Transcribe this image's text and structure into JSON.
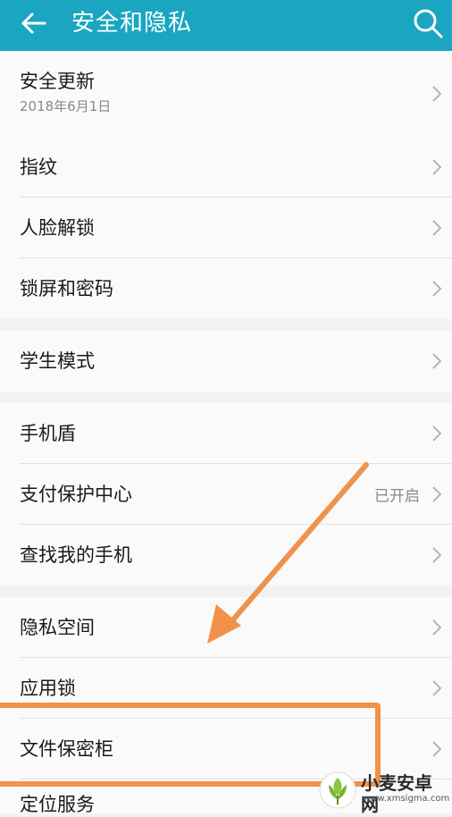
{
  "header": {
    "title": "安全和隐私",
    "back_icon": "arrow-left-icon",
    "search_icon": "search-icon"
  },
  "groups": [
    {
      "items": [
        {
          "label": "安全更新",
          "sub": "2018年6月1日"
        }
      ]
    },
    {
      "items": [
        {
          "label": "指纹"
        },
        {
          "label": "人脸解锁"
        },
        {
          "label": "锁屏和密码"
        }
      ]
    },
    {
      "items": [
        {
          "label": "学生模式"
        }
      ]
    },
    {
      "items": [
        {
          "label": "手机盾"
        },
        {
          "label": "支付保护中心",
          "status": "已开启"
        },
        {
          "label": "查找我的手机"
        }
      ]
    },
    {
      "items": [
        {
          "label": "隐私空间"
        },
        {
          "label": "应用锁"
        },
        {
          "label": "文件保密柜"
        },
        {
          "label": "定位服务"
        }
      ]
    }
  ],
  "annotation": {
    "color": "#f0924a",
    "highlighted_item": "文件保密柜"
  },
  "watermark": {
    "title": "小麦安卓网",
    "url": "www.xmsigma.com"
  },
  "colors": {
    "header_bg": "#1aa6c1",
    "row_bg": "#fafafa",
    "page_bg": "#f2f2f2",
    "secondary_text": "#8a8a8a"
  }
}
